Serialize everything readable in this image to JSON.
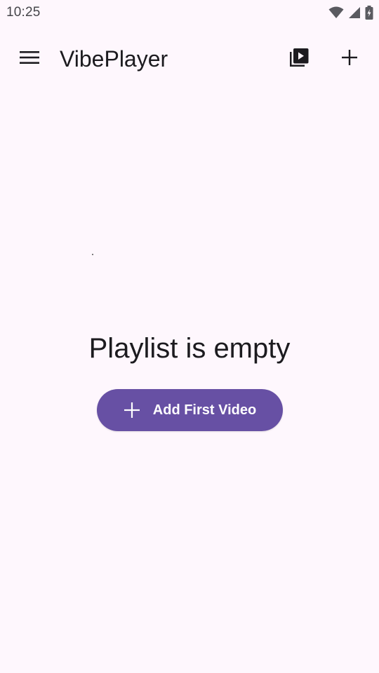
{
  "status_bar": {
    "time": "10:25",
    "icons": [
      "wifi-icon",
      "signal-icon",
      "battery-charging-icon"
    ]
  },
  "app_bar": {
    "title": "VibePlayer",
    "icons": {
      "menu": "hamburger-menu-icon",
      "playlist": "video-library-icon",
      "add": "plus-icon"
    }
  },
  "empty_state": {
    "title": "Playlist is empty",
    "button_label": "Add First Video",
    "button_icon": "plus-icon"
  },
  "colors": {
    "background": "#fef7fd",
    "primary": "#6750a4",
    "on_primary": "#ffffff",
    "text": "#1c1b1f"
  }
}
